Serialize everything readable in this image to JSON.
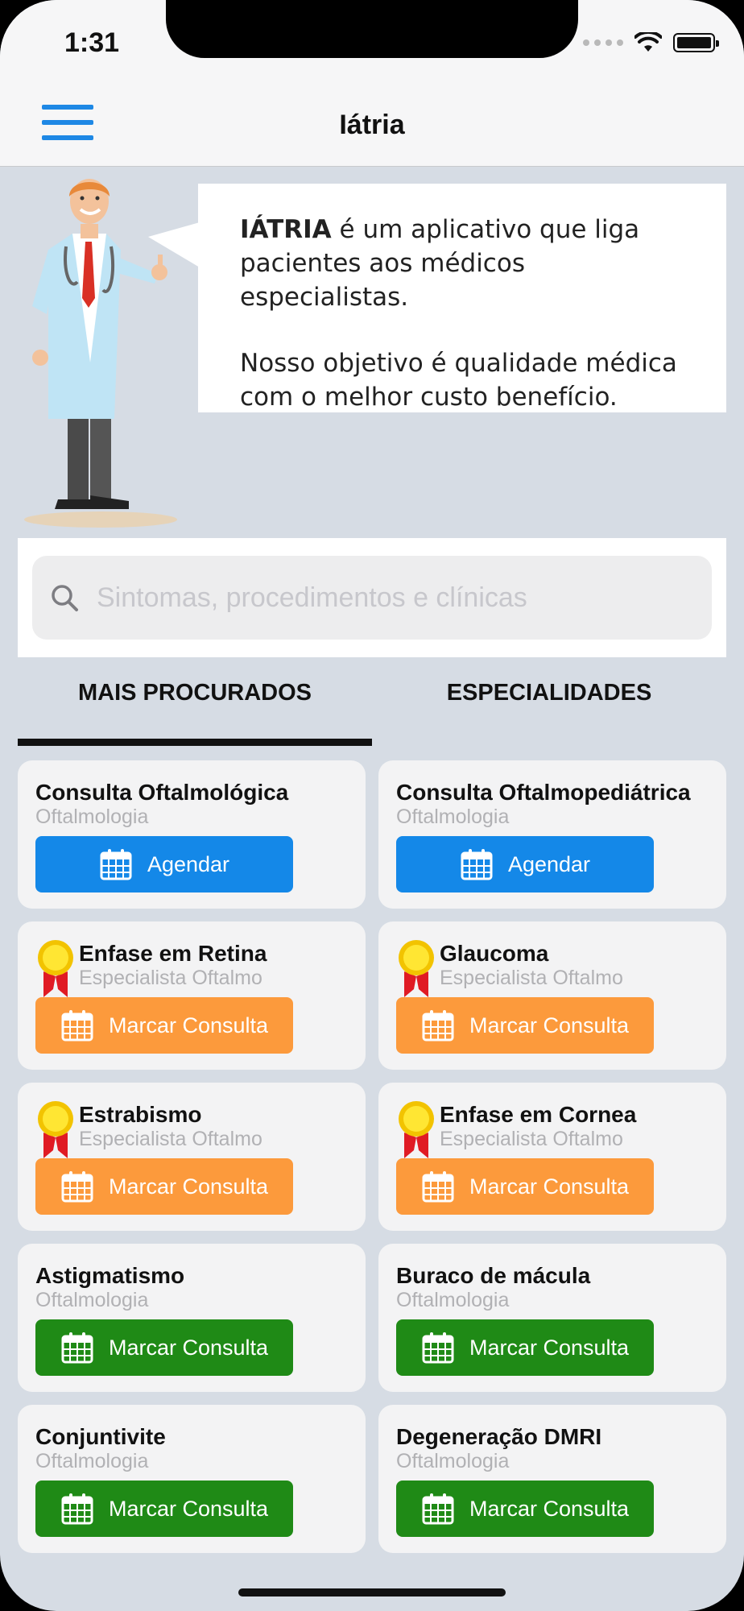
{
  "status_bar": {
    "time": "1:31"
  },
  "nav": {
    "title": "Iátria",
    "menu_icon": "hamburger-menu-icon"
  },
  "intro": {
    "brand": "IÁTRIA",
    "line1_rest": " é um aplicativo que liga pacientes aos médicos especialistas.",
    "line2": "Nosso objetivo é qualidade médica com o melhor custo benefício."
  },
  "search": {
    "placeholder": "Sintomas, procedimentos e clínicas",
    "value": ""
  },
  "tabs": [
    {
      "label": "MAIS PROCURADOS",
      "active": true
    },
    {
      "label": "ESPECIALIDADES",
      "active": false
    }
  ],
  "colors": {
    "blue": "#1488e8",
    "orange": "#fc9a3c",
    "green": "#1f8a16",
    "accent": "#1e88e5"
  },
  "cards": [
    {
      "title": "Consulta Oftalmológica",
      "subtitle": "Oftalmologia",
      "button": "Agendar",
      "color": "blue",
      "badge": false
    },
    {
      "title": "Consulta Oftalmopediátrica",
      "subtitle": "Oftalmologia",
      "button": "Agendar",
      "color": "blue",
      "badge": false
    },
    {
      "title": "Enfase em Retina",
      "subtitle": "Especialista Oftalmo",
      "button": "Marcar Consulta",
      "color": "orange",
      "badge": true
    },
    {
      "title": "Glaucoma",
      "subtitle": "Especialista Oftalmo",
      "button": "Marcar Consulta",
      "color": "orange",
      "badge": true
    },
    {
      "title": "Estrabismo",
      "subtitle": "Especialista Oftalmo",
      "button": "Marcar Consulta",
      "color": "orange",
      "badge": true
    },
    {
      "title": "Enfase em Cornea",
      "subtitle": "Especialista Oftalmo",
      "button": "Marcar Consulta",
      "color": "orange",
      "badge": true
    },
    {
      "title": "Astigmatismo",
      "subtitle": "Oftalmologia",
      "button": "Marcar Consulta",
      "color": "green",
      "badge": false
    },
    {
      "title": "Buraco de mácula",
      "subtitle": "Oftalmologia",
      "button": "Marcar Consulta",
      "color": "green",
      "badge": false
    },
    {
      "title": "Conjuntivite",
      "subtitle": "Oftalmologia",
      "button": "Marcar Consulta",
      "color": "green",
      "badge": false
    },
    {
      "title": "Degeneração DMRI",
      "subtitle": "Oftalmologia",
      "button": "Marcar Consulta",
      "color": "green",
      "badge": false
    }
  ]
}
